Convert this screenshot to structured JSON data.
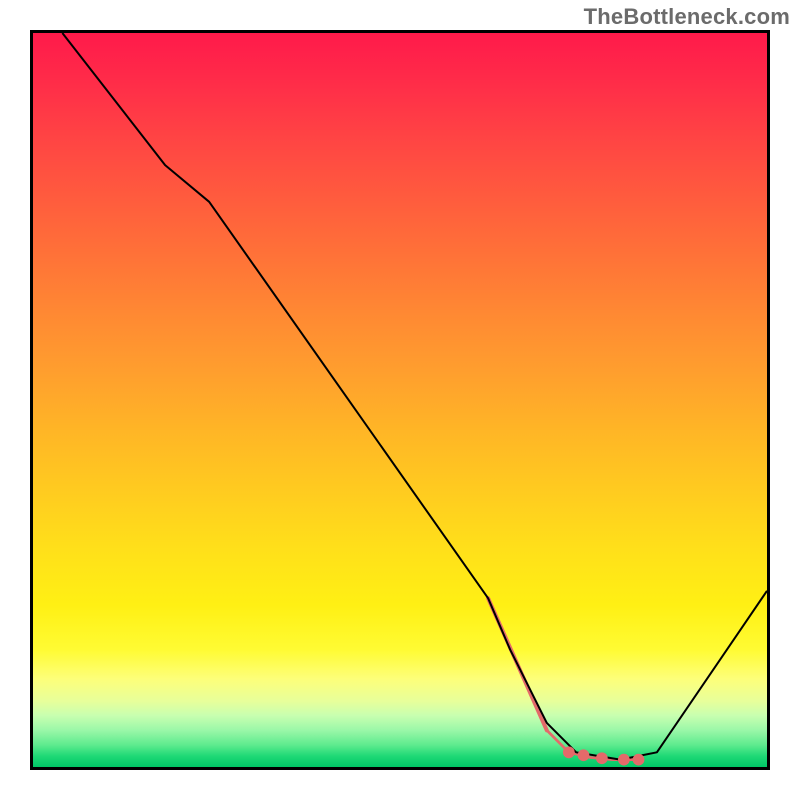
{
  "watermark": "TheBottleneck.com",
  "chart_data": {
    "type": "line",
    "title": "",
    "xlabel": "",
    "ylabel": "",
    "xlim": [
      0,
      100
    ],
    "ylim": [
      0,
      100
    ],
    "series": [
      {
        "name": "bottleneck-curve",
        "color": "#000000",
        "stroke_width": 2,
        "points": [
          {
            "x": 4,
            "y": 100
          },
          {
            "x": 18,
            "y": 82
          },
          {
            "x": 24,
            "y": 77
          },
          {
            "x": 62,
            "y": 23
          },
          {
            "x": 65,
            "y": 16
          },
          {
            "x": 70,
            "y": 6
          },
          {
            "x": 74,
            "y": 2
          },
          {
            "x": 80,
            "y": 1
          },
          {
            "x": 85,
            "y": 2
          },
          {
            "x": 100,
            "y": 24
          }
        ]
      }
    ],
    "highlight": {
      "name": "highlight-segment",
      "color": "#e46a6a",
      "points": [
        {
          "x": 62,
          "y": 23
        },
        {
          "x": 70,
          "y": 5
        },
        {
          "x": 73,
          "y": 2
        },
        {
          "x": 76,
          "y": 1.3
        },
        {
          "x": 79,
          "y": 1
        },
        {
          "x": 82,
          "y": 1
        }
      ],
      "dots": [
        {
          "x": 73,
          "y": 2.0
        },
        {
          "x": 75,
          "y": 1.6
        },
        {
          "x": 77.5,
          "y": 1.2
        },
        {
          "x": 80.5,
          "y": 1.0
        },
        {
          "x": 82.5,
          "y": 1.0
        }
      ]
    },
    "gradient_stops": [
      {
        "pct": 0,
        "color": "#ff1a4a"
      },
      {
        "pct": 50,
        "color": "#ffb526"
      },
      {
        "pct": 85,
        "color": "#fffb33"
      },
      {
        "pct": 100,
        "color": "#00c766"
      }
    ]
  }
}
